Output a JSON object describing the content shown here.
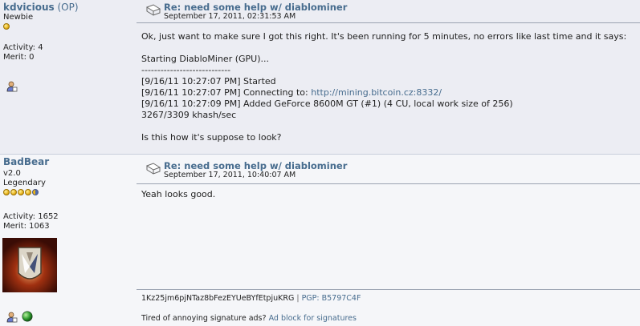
{
  "posts": [
    {
      "author": "kdvicious",
      "author_tag": " (OP)",
      "rank": "Newbie",
      "activity": "Activity: 4",
      "merit": "Merit: 0",
      "subject": "Re: need some help w/ diablominer",
      "date": "September 17, 2011, 02:31:53 AM",
      "body_lines": [
        "Ok, just want to make sure I got this right. It's been running for 5 minutes, no errors like last time and it says:",
        "",
        "Starting DiabloMiner (GPU)...",
        "----------------------------",
        "[9/16/11 10:27:07 PM] Started",
        "[9/16/11 10:27:07 PM] Connecting to: ",
        "[9/16/11 10:27:09 PM] Added GeForce 8600M GT (#1) (4 CU, local work size of 256)",
        "3267/3309 khash/sec",
        "",
        "Is this how it's suppose to look?"
      ],
      "link": "http://mining.bitcoin.cz:8332/"
    },
    {
      "author": "BadBear",
      "rank_line1": "v2.0",
      "rank": "Legendary",
      "activity": "Activity: 1652",
      "merit": "Merit: 1063",
      "subject": "Re: need some help w/ diablominer",
      "date": "September 17, 2011, 10:40:07 AM",
      "body": "Yeah looks good.",
      "signature": "1Kz25jm6pjNTaz8bFezEYUeBYfEtpjuKRG",
      "sig_sep": " | ",
      "pgp": "PGP: B5797C4F",
      "ad_text": "Tired of annoying signature ads? ",
      "ad_link": "Ad block for signatures"
    }
  ],
  "icons": {
    "subject": "message-icon",
    "profile": "profile-icon",
    "online": "globe-icon",
    "avatar": "wings-emblem-icon"
  },
  "colors": {
    "link": "#476c8e",
    "post_bg_1": "#ecedf3",
    "post_bg_2": "#f5f6f9"
  }
}
